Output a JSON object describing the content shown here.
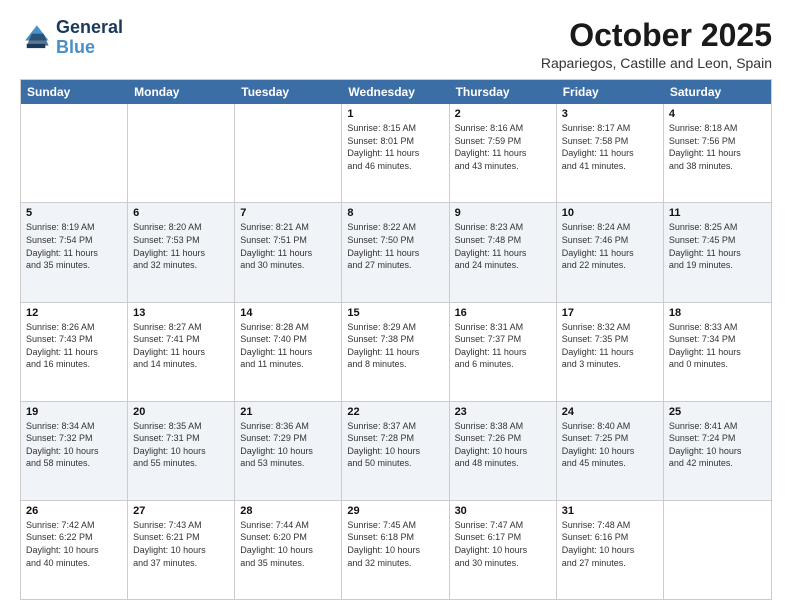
{
  "logo": {
    "line1": "General",
    "line2": "Blue"
  },
  "title": "October 2025",
  "location": "Rapariegos, Castille and Leon, Spain",
  "days_of_week": [
    "Sunday",
    "Monday",
    "Tuesday",
    "Wednesday",
    "Thursday",
    "Friday",
    "Saturday"
  ],
  "weeks": [
    {
      "alt": false,
      "cells": [
        {
          "day": "",
          "info": ""
        },
        {
          "day": "",
          "info": ""
        },
        {
          "day": "",
          "info": ""
        },
        {
          "day": "1",
          "info": "Sunrise: 8:15 AM\nSunset: 8:01 PM\nDaylight: 11 hours\nand 46 minutes."
        },
        {
          "day": "2",
          "info": "Sunrise: 8:16 AM\nSunset: 7:59 PM\nDaylight: 11 hours\nand 43 minutes."
        },
        {
          "day": "3",
          "info": "Sunrise: 8:17 AM\nSunset: 7:58 PM\nDaylight: 11 hours\nand 41 minutes."
        },
        {
          "day": "4",
          "info": "Sunrise: 8:18 AM\nSunset: 7:56 PM\nDaylight: 11 hours\nand 38 minutes."
        }
      ]
    },
    {
      "alt": true,
      "cells": [
        {
          "day": "5",
          "info": "Sunrise: 8:19 AM\nSunset: 7:54 PM\nDaylight: 11 hours\nand 35 minutes."
        },
        {
          "day": "6",
          "info": "Sunrise: 8:20 AM\nSunset: 7:53 PM\nDaylight: 11 hours\nand 32 minutes."
        },
        {
          "day": "7",
          "info": "Sunrise: 8:21 AM\nSunset: 7:51 PM\nDaylight: 11 hours\nand 30 minutes."
        },
        {
          "day": "8",
          "info": "Sunrise: 8:22 AM\nSunset: 7:50 PM\nDaylight: 11 hours\nand 27 minutes."
        },
        {
          "day": "9",
          "info": "Sunrise: 8:23 AM\nSunset: 7:48 PM\nDaylight: 11 hours\nand 24 minutes."
        },
        {
          "day": "10",
          "info": "Sunrise: 8:24 AM\nSunset: 7:46 PM\nDaylight: 11 hours\nand 22 minutes."
        },
        {
          "day": "11",
          "info": "Sunrise: 8:25 AM\nSunset: 7:45 PM\nDaylight: 11 hours\nand 19 minutes."
        }
      ]
    },
    {
      "alt": false,
      "cells": [
        {
          "day": "12",
          "info": "Sunrise: 8:26 AM\nSunset: 7:43 PM\nDaylight: 11 hours\nand 16 minutes."
        },
        {
          "day": "13",
          "info": "Sunrise: 8:27 AM\nSunset: 7:41 PM\nDaylight: 11 hours\nand 14 minutes."
        },
        {
          "day": "14",
          "info": "Sunrise: 8:28 AM\nSunset: 7:40 PM\nDaylight: 11 hours\nand 11 minutes."
        },
        {
          "day": "15",
          "info": "Sunrise: 8:29 AM\nSunset: 7:38 PM\nDaylight: 11 hours\nand 8 minutes."
        },
        {
          "day": "16",
          "info": "Sunrise: 8:31 AM\nSunset: 7:37 PM\nDaylight: 11 hours\nand 6 minutes."
        },
        {
          "day": "17",
          "info": "Sunrise: 8:32 AM\nSunset: 7:35 PM\nDaylight: 11 hours\nand 3 minutes."
        },
        {
          "day": "18",
          "info": "Sunrise: 8:33 AM\nSunset: 7:34 PM\nDaylight: 11 hours\nand 0 minutes."
        }
      ]
    },
    {
      "alt": true,
      "cells": [
        {
          "day": "19",
          "info": "Sunrise: 8:34 AM\nSunset: 7:32 PM\nDaylight: 10 hours\nand 58 minutes."
        },
        {
          "day": "20",
          "info": "Sunrise: 8:35 AM\nSunset: 7:31 PM\nDaylight: 10 hours\nand 55 minutes."
        },
        {
          "day": "21",
          "info": "Sunrise: 8:36 AM\nSunset: 7:29 PM\nDaylight: 10 hours\nand 53 minutes."
        },
        {
          "day": "22",
          "info": "Sunrise: 8:37 AM\nSunset: 7:28 PM\nDaylight: 10 hours\nand 50 minutes."
        },
        {
          "day": "23",
          "info": "Sunrise: 8:38 AM\nSunset: 7:26 PM\nDaylight: 10 hours\nand 48 minutes."
        },
        {
          "day": "24",
          "info": "Sunrise: 8:40 AM\nSunset: 7:25 PM\nDaylight: 10 hours\nand 45 minutes."
        },
        {
          "day": "25",
          "info": "Sunrise: 8:41 AM\nSunset: 7:24 PM\nDaylight: 10 hours\nand 42 minutes."
        }
      ]
    },
    {
      "alt": false,
      "cells": [
        {
          "day": "26",
          "info": "Sunrise: 7:42 AM\nSunset: 6:22 PM\nDaylight: 10 hours\nand 40 minutes."
        },
        {
          "day": "27",
          "info": "Sunrise: 7:43 AM\nSunset: 6:21 PM\nDaylight: 10 hours\nand 37 minutes."
        },
        {
          "day": "28",
          "info": "Sunrise: 7:44 AM\nSunset: 6:20 PM\nDaylight: 10 hours\nand 35 minutes."
        },
        {
          "day": "29",
          "info": "Sunrise: 7:45 AM\nSunset: 6:18 PM\nDaylight: 10 hours\nand 32 minutes."
        },
        {
          "day": "30",
          "info": "Sunrise: 7:47 AM\nSunset: 6:17 PM\nDaylight: 10 hours\nand 30 minutes."
        },
        {
          "day": "31",
          "info": "Sunrise: 7:48 AM\nSunset: 6:16 PM\nDaylight: 10 hours\nand 27 minutes."
        },
        {
          "day": "",
          "info": ""
        }
      ]
    }
  ]
}
